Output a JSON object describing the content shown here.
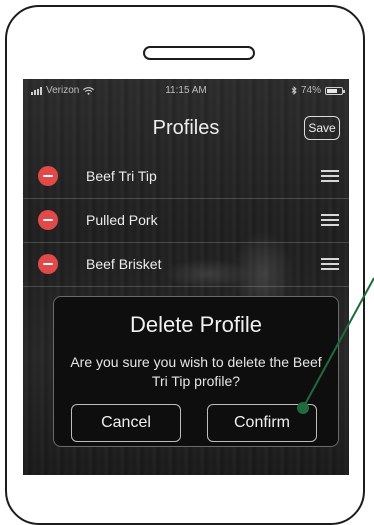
{
  "status_bar": {
    "carrier": "Verizon",
    "time": "11:15 AM",
    "battery": "74%",
    "battery_level": 0.74
  },
  "header": {
    "title": "Profiles",
    "save_label": "Save"
  },
  "profiles": [
    {
      "label": "Beef Tri Tip"
    },
    {
      "label": "Pulled Pork"
    },
    {
      "label": "Beef Brisket"
    }
  ],
  "dialog": {
    "title": "Delete Profile",
    "message": "Are you sure you wish to delete the Beef Tri Tip profile?",
    "cancel_label": "Cancel",
    "confirm_label": "Confirm"
  },
  "colors": {
    "delete_red": "#e24a4a",
    "callout_green": "#1f6b3d"
  },
  "icons": [
    "wifi-icon",
    "bluetooth-icon",
    "battery-icon",
    "delete-minus-icon",
    "reorder-icon"
  ]
}
